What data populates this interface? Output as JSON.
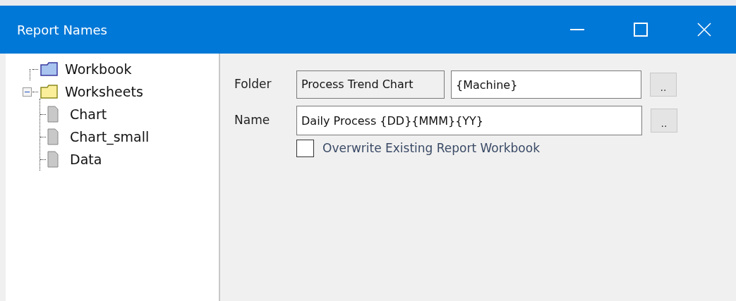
{
  "window": {
    "title": "Report Names"
  },
  "tree": [
    {
      "label": "Workbook",
      "kind": "workbook"
    },
    {
      "label": "Worksheets",
      "kind": "folder",
      "expanded": true,
      "children": [
        {
          "label": "Chart",
          "kind": "sheet"
        },
        {
          "label": "Chart_small",
          "kind": "sheet"
        },
        {
          "label": "Data",
          "kind": "sheet"
        }
      ]
    }
  ],
  "folder": {
    "label": "Folder",
    "base": "Process Trend Chart",
    "value": "{Machine}",
    "browse": ".."
  },
  "name": {
    "label": "Name",
    "value": "Daily Process {DD}{MMM}{YY}",
    "browse": ".."
  },
  "overwrite": {
    "label": "Overwrite Existing Report Workbook",
    "checked": false
  }
}
